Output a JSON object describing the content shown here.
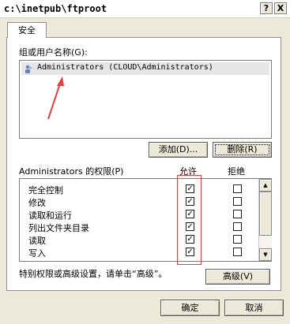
{
  "window": {
    "title": "c:\\inetpub\\ftproot",
    "help_button": "?",
    "close_button": "X"
  },
  "tab": {
    "label": "安全"
  },
  "group_section": {
    "label": "组或用户名称(G):",
    "users": [
      {
        "name": "Administrators (CLOUD\\Administrators)",
        "selected": true
      }
    ],
    "add_button": "添加(D)...",
    "remove_button": "删除(R)"
  },
  "permissions": {
    "label": "Administrators 的权限(P)",
    "allow_header": "允许",
    "deny_header": "拒绝",
    "rows": [
      {
        "name": "完全控制",
        "allow": true,
        "deny": false
      },
      {
        "name": "修改",
        "allow": true,
        "deny": false
      },
      {
        "name": "读取和运行",
        "allow": true,
        "deny": false
      },
      {
        "name": "列出文件夹目录",
        "allow": true,
        "deny": false
      },
      {
        "name": "读取",
        "allow": true,
        "deny": false
      },
      {
        "name": "写入",
        "allow": true,
        "deny": false
      }
    ]
  },
  "advanced": {
    "hint": "特别权限或高级设置，请单击“高级”。",
    "button": "高级(V)"
  },
  "footer": {
    "ok_button": "确定",
    "cancel_button": "取消"
  },
  "colors": {
    "annotation_red": "#e04040",
    "window_bg": "#ece9d8"
  }
}
